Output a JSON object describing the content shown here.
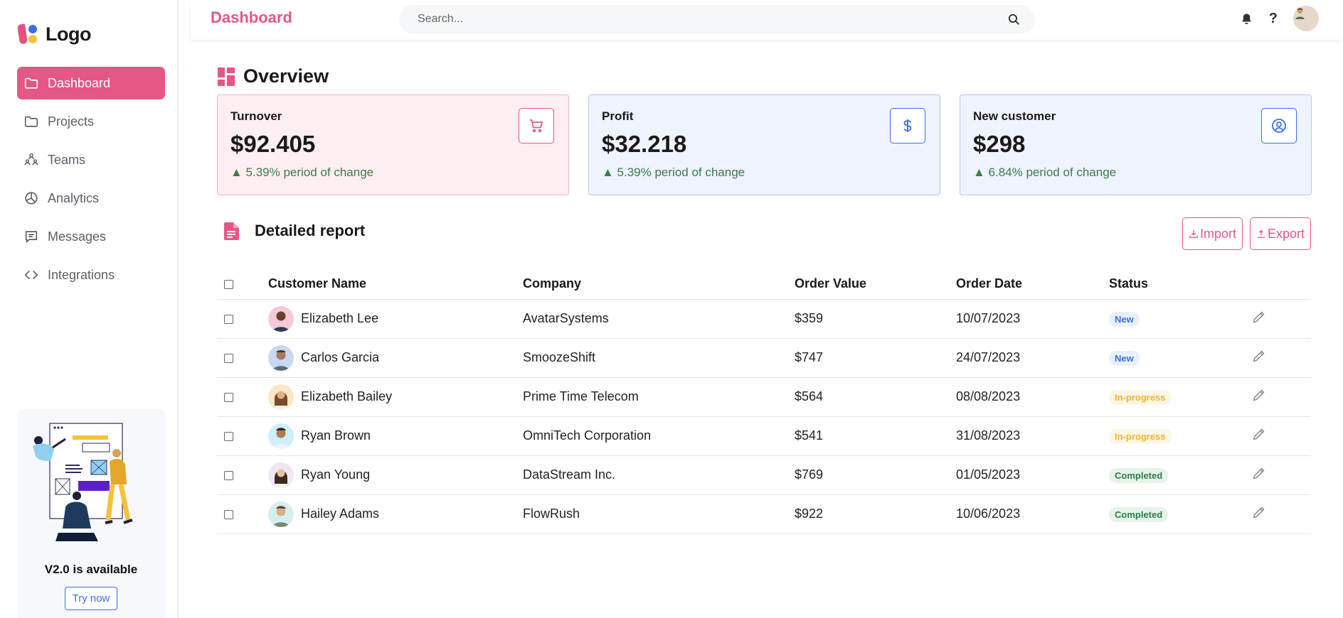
{
  "brand": {
    "logo_text": "Logo"
  },
  "sidebar": {
    "items": [
      {
        "label": "Dashboard",
        "icon": "folder-icon",
        "active": true
      },
      {
        "label": "Projects",
        "icon": "folder-icon",
        "active": false
      },
      {
        "label": "Teams",
        "icon": "teams-icon",
        "active": false
      },
      {
        "label": "Analytics",
        "icon": "pie-chart-icon",
        "active": false
      },
      {
        "label": "Messages",
        "icon": "message-icon",
        "active": false
      },
      {
        "label": "Integrations",
        "icon": "code-icon",
        "active": false
      }
    ],
    "promo": {
      "title": "V2.0 is available",
      "button": "Try now"
    }
  },
  "header": {
    "title": "Dashboard",
    "search_placeholder": "Search...",
    "help_label": "?"
  },
  "overview": {
    "title": "Overview",
    "cards": [
      {
        "label": "Turnover",
        "value": "$92.405",
        "change": "▲ 5.39% period of change",
        "icon": "cart-icon",
        "theme": "pink"
      },
      {
        "label": "Profit",
        "value": "$32.218",
        "change": "▲ 5.39% period of change",
        "icon": "dollar-icon",
        "theme": "blue"
      },
      {
        "label": "New customer",
        "value": "$298",
        "change": "▲ 6.84% period of change",
        "icon": "user-circle-icon",
        "theme": "blue"
      }
    ]
  },
  "report": {
    "title": "Detailed report",
    "import_label": "Import",
    "export_label": "Export",
    "columns": [
      "Customer Name",
      "Company",
      "Order Value",
      "Order Date",
      "Status"
    ],
    "rows": [
      {
        "name": "Elizabeth Lee",
        "company": "AvatarSystems",
        "value": "$359",
        "date": "10/07/2023",
        "status": "New"
      },
      {
        "name": "Carlos Garcia",
        "company": "SmoozeShift",
        "value": "$747",
        "date": "24/07/2023",
        "status": "New"
      },
      {
        "name": "Elizabeth Bailey",
        "company": "Prime Time Telecom",
        "value": "$564",
        "date": "08/08/2023",
        "status": "In-progress"
      },
      {
        "name": "Ryan Brown",
        "company": "OmniTech Corporation",
        "value": "$541",
        "date": "31/08/2023",
        "status": "In-progress"
      },
      {
        "name": "Ryan Young",
        "company": "DataStream Inc.",
        "value": "$769",
        "date": "01/05/2023",
        "status": "Completed"
      },
      {
        "name": "Hailey Adams",
        "company": "FlowRush",
        "value": "$922",
        "date": "10/06/2023",
        "status": "Completed"
      }
    ]
  },
  "colors": {
    "accent": "#e55785",
    "blue": "#3b6ee8",
    "green": "#3a7d4a"
  }
}
